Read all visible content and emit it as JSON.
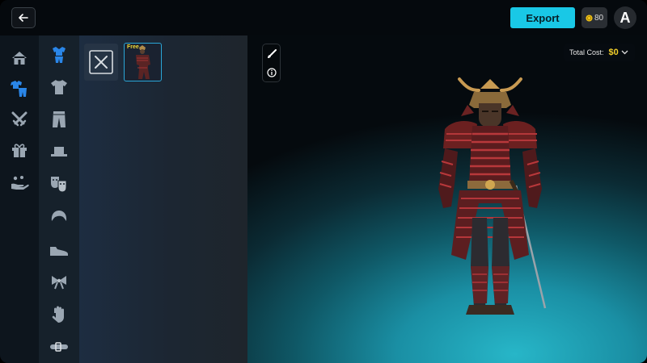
{
  "header": {
    "back_icon": "arrow-left-icon",
    "export_label": "Export",
    "coins": "80",
    "avatar_initial": "A"
  },
  "categories": [
    {
      "icon": "home-icon"
    },
    {
      "icon": "outfit-icon",
      "selected": true
    },
    {
      "icon": "crossed-swords-icon"
    },
    {
      "icon": "gift-box-icon"
    },
    {
      "icon": "emote-hand-icon"
    }
  ],
  "subcategories": [
    {
      "icon": "full-outfit-icon",
      "selected": true
    },
    {
      "icon": "shirt-icon"
    },
    {
      "icon": "pants-icon"
    },
    {
      "icon": "hat-icon"
    },
    {
      "icon": "masks-icon"
    },
    {
      "icon": "hair-icon"
    },
    {
      "icon": "shoe-icon"
    },
    {
      "icon": "bow-icon"
    },
    {
      "icon": "glove-icon"
    },
    {
      "icon": "belt-icon"
    }
  ],
  "items": {
    "none_icon": "x-icon",
    "selected_item_badge": "Free"
  },
  "viewport": {
    "tools": [
      "brush-icon",
      "info-icon"
    ],
    "total_cost_label": "Total Cost:",
    "total_cost_value": "$0"
  },
  "colors": {
    "accent": "#19c8e6",
    "selected_icon": "#2a86e8",
    "cost": "#f2cf2a",
    "free_badge": "#f1d936"
  }
}
